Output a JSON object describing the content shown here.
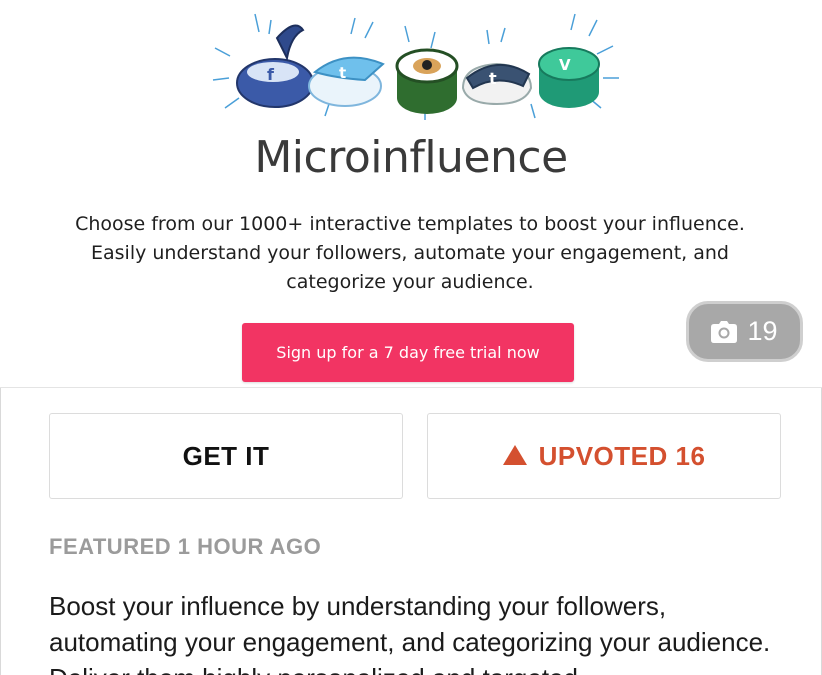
{
  "hero": {
    "title": "Microinfluence",
    "description": "Choose from our 1000+ interactive templates to boost your influence. Easily understand your followers, automate your engagement, and categorize your audience.",
    "cta_label": "Sign up for a 7 day free trial now",
    "art_icons": [
      "facebook-sushi-icon",
      "twitter-sushi-icon",
      "instagram-sushi-icon",
      "tumblr-sushi-icon",
      "vine-sushi-icon"
    ]
  },
  "gallery": {
    "count": "19",
    "icon": "camera-icon"
  },
  "actions": {
    "get_label": "GET IT",
    "upvote_label": "UPVOTED 16",
    "upvote_color": "#d4502f"
  },
  "post": {
    "featured": "FEATURED 1 HOUR AGO",
    "description": "Boost your influence by understanding your followers, automating your engagement, and categorizing your audience. Deliver them highly personalized and targeted"
  },
  "colors": {
    "cta": "#f23463",
    "badge": "#a8a8a8"
  }
}
